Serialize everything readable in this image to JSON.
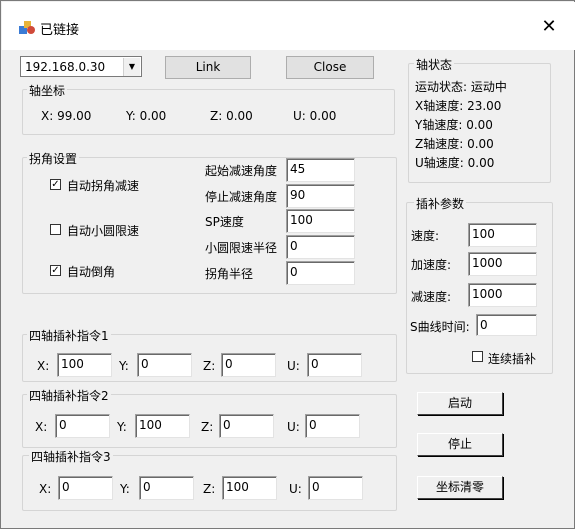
{
  "window": {
    "title": "已链接",
    "close_glyph": "✕"
  },
  "connection": {
    "ip_value": "192.168.0.30",
    "link_label": "Link",
    "close_label": "Close"
  },
  "axis_coords": {
    "title": "轴坐标",
    "x": "X: 99.00",
    "y": "Y: 0.00",
    "z": "Z: 0.00",
    "u": "U: 0.00"
  },
  "axis_status": {
    "title": "轴状态",
    "motion": "运动状态: 运动中",
    "x_speed": "X轴速度: 23.00",
    "y_speed": "Y轴速度: 0.00",
    "z_speed": "Z轴速度: 0.00",
    "u_speed": "U轴速度: 0.00"
  },
  "corner": {
    "title": "拐角设置",
    "auto_corner_decel": {
      "label": "自动拐角减速",
      "checked": true
    },
    "auto_small_circle": {
      "label": "自动小圆限速",
      "checked": false
    },
    "auto_chamfer": {
      "label": "自动倒角",
      "checked": true
    },
    "start_decel_angle": {
      "label": "起始减速角度",
      "value": "45"
    },
    "stop_decel_angle": {
      "label": "停止减速角度",
      "value": "90"
    },
    "sp_speed": {
      "label": "SP速度",
      "value": "100"
    },
    "small_circle_radius": {
      "label": "小圆限速半径",
      "value": "0"
    },
    "corner_radius": {
      "label": "拐角半径",
      "value": "0"
    }
  },
  "interp": {
    "title": "插补参数",
    "speed": {
      "label": "速度:",
      "value": "100"
    },
    "accel": {
      "label": "加速度:",
      "value": "1000"
    },
    "decel": {
      "label": "减速度:",
      "value": "1000"
    },
    "s_curve": {
      "label": "S曲线时间:",
      "value": "0"
    },
    "continuous": {
      "label": "连续插补",
      "checked": false
    }
  },
  "cmd1": {
    "title": "四轴插补指令1",
    "x_label": "X:",
    "x": "100",
    "y_label": "Y:",
    "y": "0",
    "z_label": "Z:",
    "z": "0",
    "u_label": "U:",
    "u": "0"
  },
  "cmd2": {
    "title": "四轴插补指令2",
    "x_label": "X:",
    "x": "0",
    "y_label": "Y:",
    "y": "100",
    "z_label": "Z:",
    "z": "0",
    "u_label": "U:",
    "u": "0"
  },
  "cmd3": {
    "title": "四轴插补指令3",
    "x_label": "X:",
    "x": "0",
    "y_label": "Y:",
    "y": "0",
    "z_label": "Z:",
    "z": "100",
    "u_label": "U:",
    "u": "0"
  },
  "buttons": {
    "start": "启动",
    "stop": "停止",
    "clear": "坐标清零"
  }
}
